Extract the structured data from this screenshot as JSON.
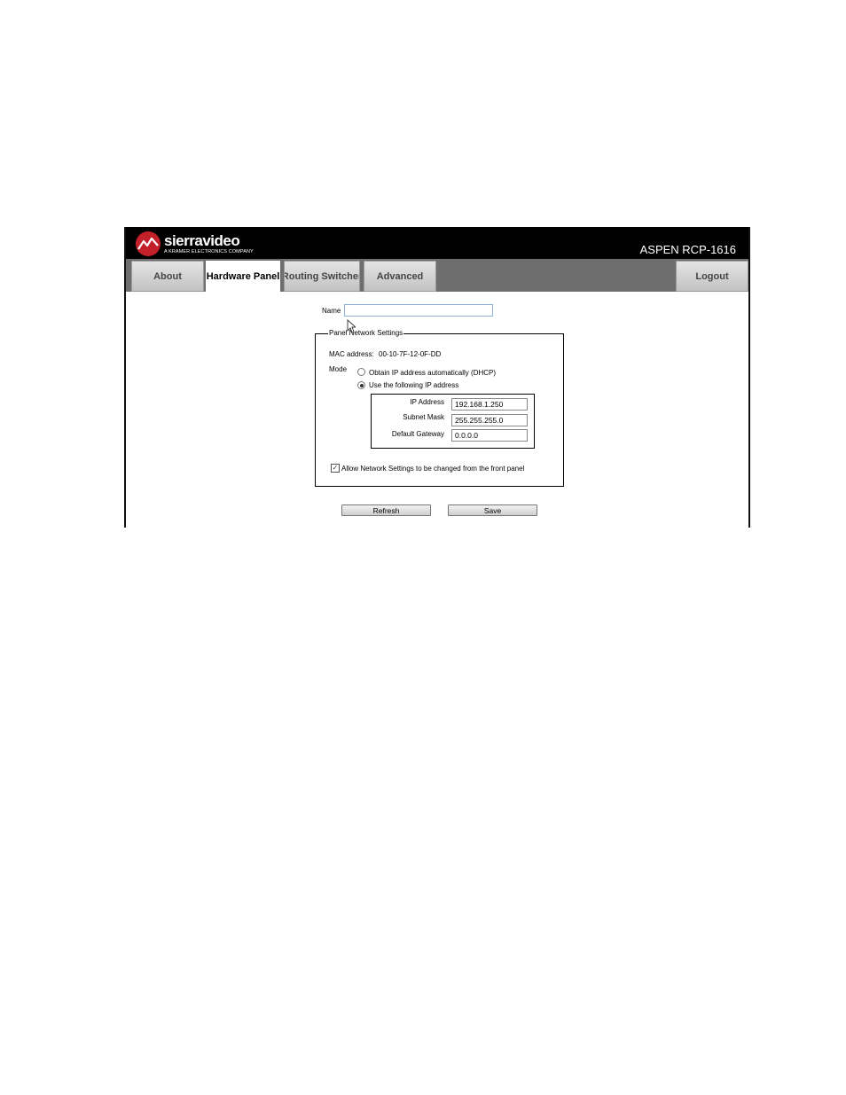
{
  "header": {
    "brand": "sierravideo",
    "brand_sub": "A KRAMER ELECTRONICS COMPANY",
    "product": "ASPEN RCP-1616"
  },
  "tabs": [
    {
      "label": "About",
      "active": false
    },
    {
      "label": "Hardware Panel",
      "active": true
    },
    {
      "label": "Routing Switcher",
      "active": false
    },
    {
      "label": "Advanced",
      "active": false
    }
  ],
  "logout_label": "Logout",
  "form": {
    "name_label": "Name",
    "name_value": "",
    "panel_settings": {
      "legend": "Panel Network Settings",
      "mac_label": "MAC address:",
      "mac_value": "00-10-7F-12-0F-DD",
      "mode_label": "Mode",
      "mode_options": [
        {
          "label": "Obtain IP address automatically (DHCP)",
          "selected": false
        },
        {
          "label": "Use the following IP address",
          "selected": true
        }
      ],
      "ip_address_label": "IP Address",
      "ip_address_value": "192.168.1.250",
      "subnet_mask_label": "Subnet Mask",
      "subnet_mask_value": "255.255.255.0",
      "gateway_label": "Default Gateway",
      "gateway_value": "0.0.0.0",
      "allow_front_panel_label": "Allow Network Settings to be changed from the front panel",
      "allow_front_panel_checked": true
    },
    "refresh_label": "Refresh",
    "save_label": "Save"
  },
  "colors": {
    "brand_red": "#c4202a",
    "header_bg": "#000000",
    "tabbar_bg": "#6e6e6e"
  }
}
